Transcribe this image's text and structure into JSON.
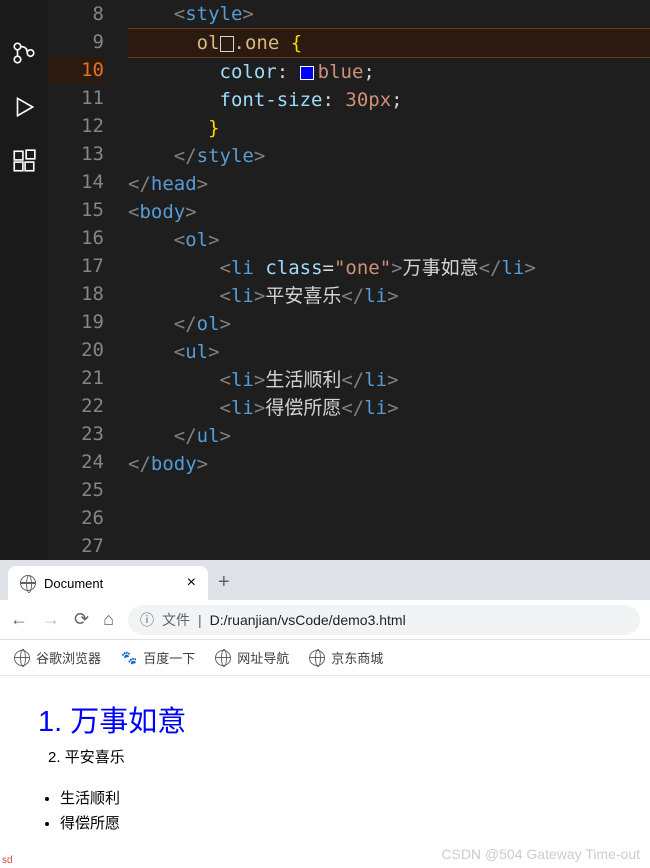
{
  "editor": {
    "lines": [
      {
        "num": "8"
      },
      {
        "num": "9"
      },
      {
        "num": "10"
      },
      {
        "num": "11"
      },
      {
        "num": "12"
      },
      {
        "num": "13"
      },
      {
        "num": "14"
      },
      {
        "num": "15"
      },
      {
        "num": "16"
      },
      {
        "num": "17"
      },
      {
        "num": "18"
      },
      {
        "num": "19"
      },
      {
        "num": "20"
      },
      {
        "num": "21"
      },
      {
        "num": "22"
      },
      {
        "num": "23"
      },
      {
        "num": "24"
      },
      {
        "num": "25"
      },
      {
        "num": "26"
      },
      {
        "num": "27"
      }
    ],
    "code": {
      "style_open": "style",
      "selector": "ol",
      "class_sel": ".one",
      "color_prop": "color",
      "color_val": "blue",
      "fontsize_prop": "font-size",
      "fontsize_val": "30px",
      "style_close": "style",
      "head_close": "head",
      "body_open": "body",
      "ol_open": "ol",
      "li": "li",
      "class_attr": "class",
      "class_val": "\"one\"",
      "li_text1": "万事如意",
      "li_text2": "平安喜乐",
      "ol_close": "ol",
      "ul_open": "ul",
      "li_text3": "生活顺利",
      "li_text4": "得偿所愿",
      "ul_close": "ul",
      "body_close": "body"
    }
  },
  "browser": {
    "tab_title": "Document",
    "addr_prefix": "文件",
    "addr_path": "D:/ruanjian/vsCode/demo3.html",
    "bookmarks": [
      {
        "label": "谷歌浏览器"
      },
      {
        "label": "百度一下"
      },
      {
        "label": "网址导航"
      },
      {
        "label": "京东商城"
      }
    ],
    "content": {
      "item1_prefix": "1. ",
      "item1": "万事如意",
      "item2_prefix": "2. ",
      "item2": "平安喜乐",
      "item3": "生活顺利",
      "item4": "得偿所愿"
    }
  },
  "watermark": "CSDN @504 Gateway Time-out",
  "sd": "sd"
}
